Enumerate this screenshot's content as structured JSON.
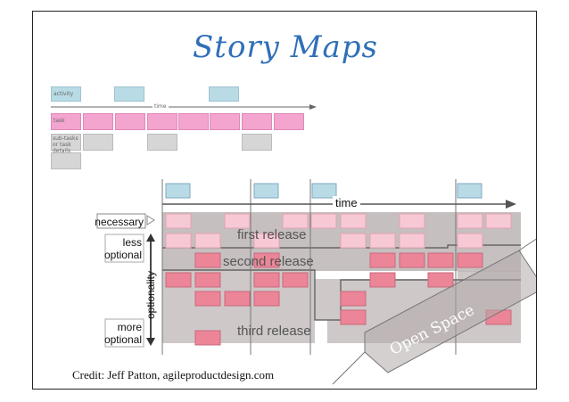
{
  "slide": {
    "title": "Story Maps",
    "credit": "Credit: Jeff Patton, agileproductdesign.com"
  },
  "small_map": {
    "activity_label": "activity",
    "time_label": "time",
    "task_label": "task",
    "subtask_label": "sub-tasks or task details"
  },
  "big_map": {
    "time_label": "time",
    "necessary_label": "necessary",
    "less_optional_line1": "less",
    "less_optional_line2": "optional",
    "optionality_label": "optionality",
    "more_optional_line1": "more",
    "more_optional_line2": "optional",
    "release_1": "first release",
    "release_2": "second release",
    "release_3": "third release"
  },
  "banner": {
    "text": "Open Space"
  },
  "colors": {
    "title": "#2f6fb7",
    "activity_blue": "#b9dbe6",
    "task_pink": "#f3a4cf",
    "card_pink": "#f7c9d4",
    "card_red": "#ec8597",
    "release_grey": "#b3aaaa"
  }
}
